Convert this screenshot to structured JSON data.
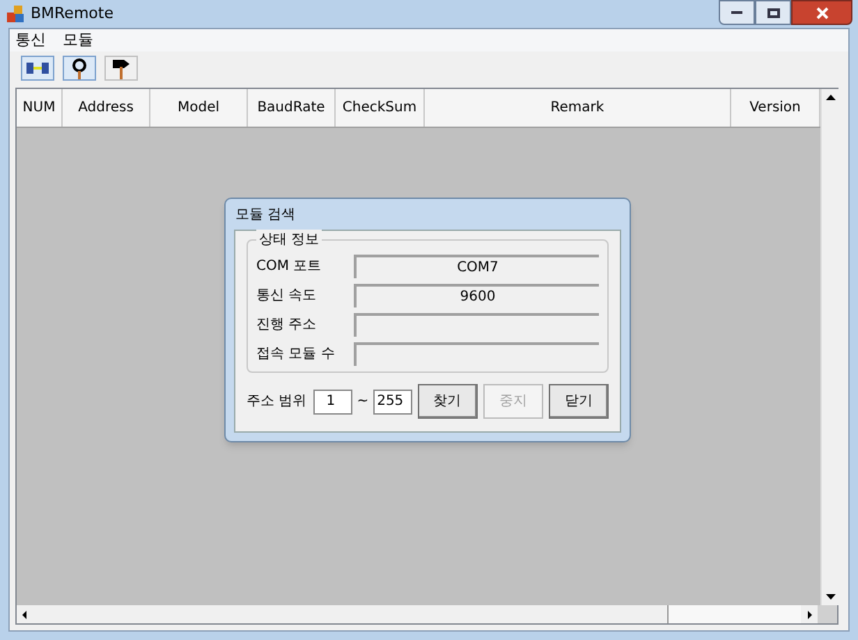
{
  "window": {
    "title": "BMRemote"
  },
  "menu": [
    "통신",
    "모듈"
  ],
  "toolbar": [
    {
      "kind": "connect",
      "selected": true
    },
    {
      "kind": "search",
      "selected": true
    },
    {
      "kind": "flag",
      "selected": false
    }
  ],
  "table": {
    "columns": [
      "NUM",
      "Address",
      "Model",
      "BaudRate",
      "CheckSum",
      "Remark",
      "Version"
    ]
  },
  "dialog": {
    "title": "모듈 검색",
    "group_title": "상태 정보",
    "fields": [
      {
        "label": "COM 포트",
        "value": "COM7"
      },
      {
        "label": "통신 속도",
        "value": "9600"
      },
      {
        "label": "진행 주소"
      },
      {
        "label": "접속 모듈 수"
      }
    ],
    "range_label": "주소 범위",
    "range_from": "1",
    "range_separator": "~",
    "range_to": "255",
    "buttons": [
      {
        "label": "찾기",
        "disabled": false
      },
      {
        "label": "중지",
        "disabled": true
      },
      {
        "label": "닫기",
        "disabled": false
      }
    ]
  }
}
